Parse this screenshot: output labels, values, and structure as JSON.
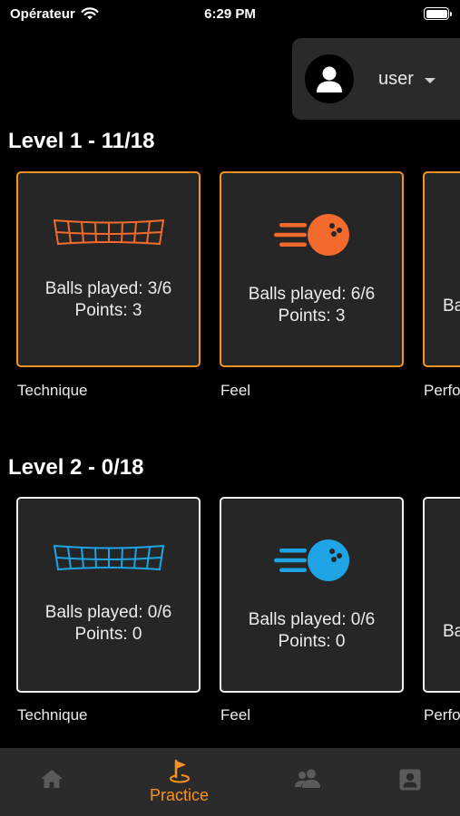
{
  "status_bar": {
    "carrier": "Opérateur",
    "time": "6:29 PM"
  },
  "user_menu": {
    "name": "user"
  },
  "levels": [
    {
      "title": "Level 1 - 11/18",
      "accent": "#f26b2c",
      "cards": [
        {
          "caption": "Technique",
          "balls": "Balls played: 3/6",
          "points": "Points: 3"
        },
        {
          "caption": "Feel",
          "balls": "Balls played: 6/6",
          "points": "Points: 3"
        },
        {
          "caption": "Perfo",
          "balls": "Ba"
        }
      ]
    },
    {
      "title": "Level 2 - 0/18",
      "accent": "#1ea4e4",
      "cards": [
        {
          "caption": "Technique",
          "balls": "Balls played: 0/6",
          "points": "Points: 0"
        },
        {
          "caption": "Feel",
          "balls": "Balls played: 0/6",
          "points": "Points: 0"
        },
        {
          "caption": "Perfo",
          "balls": "Ba"
        }
      ]
    }
  ],
  "tab_bar": {
    "active_color": "#f7931e",
    "inactive_color": "#5b5b5b",
    "tabs": [
      {
        "icon": "home-icon"
      },
      {
        "icon": "golf-flag-icon",
        "label": "Practice"
      },
      {
        "icon": "group-icon"
      },
      {
        "icon": "profile-icon"
      }
    ]
  }
}
